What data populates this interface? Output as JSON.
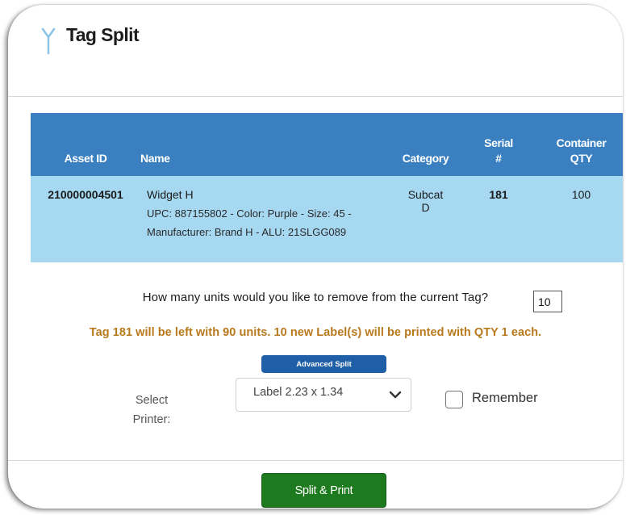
{
  "dialog": {
    "title": "Tag Split",
    "icon": "tag-split-icon"
  },
  "table": {
    "headers": {
      "asset_id": "Asset ID",
      "name": "Name",
      "category": "Category",
      "serial_line1": "Serial",
      "serial_line2": "#",
      "qty_line1": "Container",
      "qty_line2": "QTY"
    },
    "row": {
      "asset_id": "210000004501",
      "name": "Widget H",
      "detail": "UPC: 887155802 - Color: Purple - Size: 45 - Manufacturer: Brand H - ALU: 21SLGG089",
      "category_line1": "Subcat",
      "category_line2": "D",
      "serial": "181",
      "container_qty": "100"
    }
  },
  "split": {
    "question": "How many units would you like to remove from the current Tag?",
    "units_value": "10",
    "notice": "Tag 181 will be left with 90 units. 10 new Label(s) will be printed with QTY 1 each.",
    "advanced_button": "Advanced Split"
  },
  "printer": {
    "label_line1": "Select",
    "label_line2": "Printer:",
    "selected": "Label 2.23 x 1.34",
    "remember_label": "Remember",
    "remember_checked": false
  },
  "footer": {
    "split_print_button": "Split & Print"
  },
  "colors": {
    "header_bg": "#3a80c1",
    "row_bg": "#a6d8f2",
    "notice_text": "#b8791d",
    "advanced_button_bg": "#1e5fa8",
    "primary_button_bg": "#1e7a1e"
  }
}
